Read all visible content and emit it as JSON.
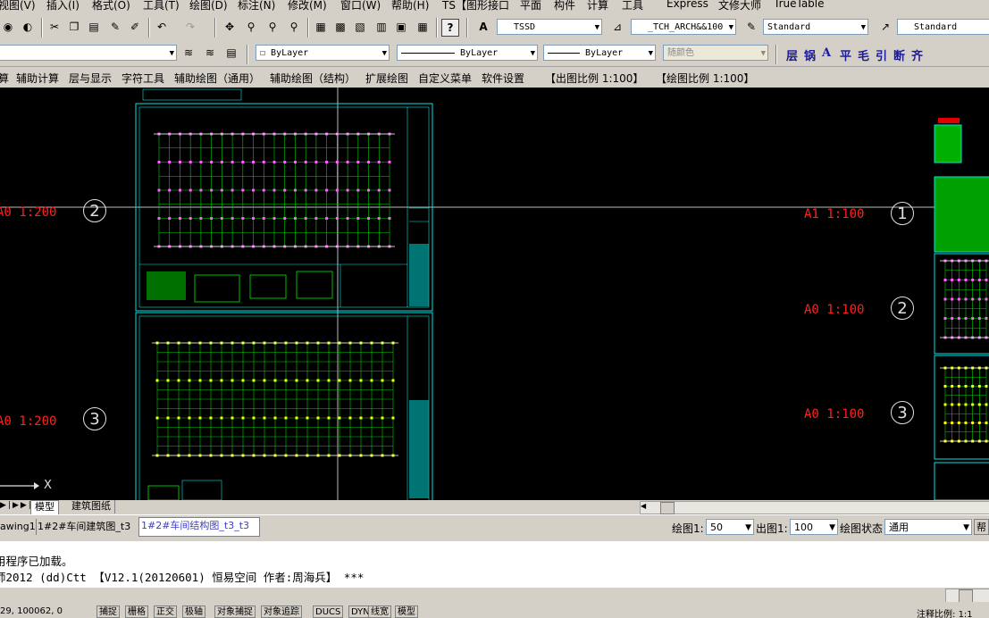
{
  "menubar": [
    "视图(V)",
    "插入(I)",
    "格式(O)",
    "工具(T)",
    "绘图(D)",
    "标注(N)",
    "修改(M)",
    "窗口(W)",
    "帮助(H)",
    "TS【图形接口",
    "平面",
    "构件",
    "计算",
    "工具",
    "Express",
    "文修大师",
    "TrueTable"
  ],
  "toolbar1": {
    "textstyle": "TSSD",
    "dimstyle": "_TCH_ARCH&&100",
    "tablestyle": "Standard",
    "mleaderstyle": "Standard"
  },
  "toolbar2": {
    "layer": "ByLayer",
    "linetype1": "ByLayer",
    "linetype2": "ByLayer",
    "color": "随颜色",
    "tools": [
      "层",
      "锅",
      "A",
      "平",
      "毛",
      "引",
      "断",
      "齐"
    ]
  },
  "menu2": [
    "算",
    "辅助计算",
    "层与显示",
    "字符工具",
    "辅助绘图（通用）",
    "辅助绘图（结构）",
    "扩展绘图",
    "自定义菜单",
    "软件设置",
    "【出图比例 1:100】",
    "【绘图比例 1:100】"
  ],
  "viewport_labels": [
    {
      "scale": "A0 1:200",
      "num": "2"
    },
    {
      "scale": "A0 1:200",
      "num": "3"
    },
    {
      "scale": "A1 1:100",
      "num": "1"
    },
    {
      "scale": "A0 1:100",
      "num": "2"
    },
    {
      "scale": "A0 1:100",
      "num": "3"
    }
  ],
  "ucs_label": "X",
  "layout_tabs": [
    "模型",
    "建筑图纸"
  ],
  "doc_tabs": [
    "awing1",
    "1#2#车间建筑图_t3",
    "1#2#车间结构图_t3_t3"
  ],
  "scale_bar": {
    "draw_label": "绘图1:",
    "draw_value": "50",
    "out_label": "出图1:",
    "out_value": "100",
    "state_label": "绘图状态",
    "state_value": "通用",
    "help": "帮"
  },
  "command_lines": [
    "用程序已加载。",
    "师2012 (dd)Ctt 【V12.1(20120601) 恒易空间 作者:周海兵】 ***"
  ],
  "status": {
    "coords": "29, 100062, 0",
    "buttons": [
      "捕捉",
      "栅格",
      "正交",
      "极轴",
      "对象捕捉",
      "对象追踪",
      "DUCS",
      "DYN",
      "线宽",
      "模型"
    ],
    "annot": "注释比例:",
    "annot_value": "1:1"
  },
  "colors": {
    "canvas": "#000000",
    "frame": "#00e5e5",
    "grid": "#00ff00",
    "label": "#ff2020"
  }
}
